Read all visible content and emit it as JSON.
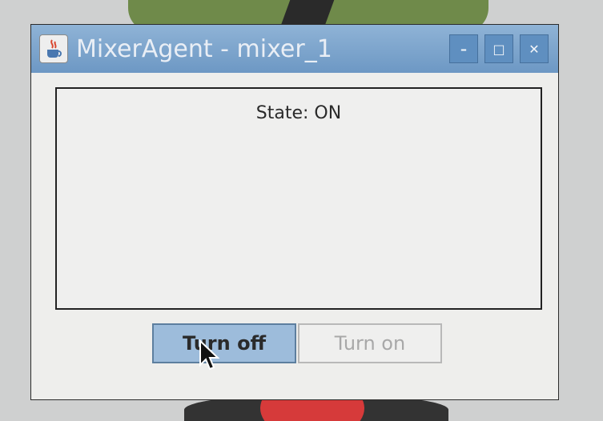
{
  "window": {
    "title": "MixerAgent - mixer_1"
  },
  "titlebar": {
    "minimize_label": "–",
    "maximize_label": "□",
    "close_label": "✕",
    "icon": "java-app-icon"
  },
  "main": {
    "state_text": "State: ON"
  },
  "buttons": {
    "turn_off_label": "Turn off",
    "turn_on_label": "Turn on"
  },
  "colors": {
    "titlebar": "#7fa6cf",
    "active_button": "#9dbcdb",
    "disabled_text": "#a8a8a8"
  }
}
